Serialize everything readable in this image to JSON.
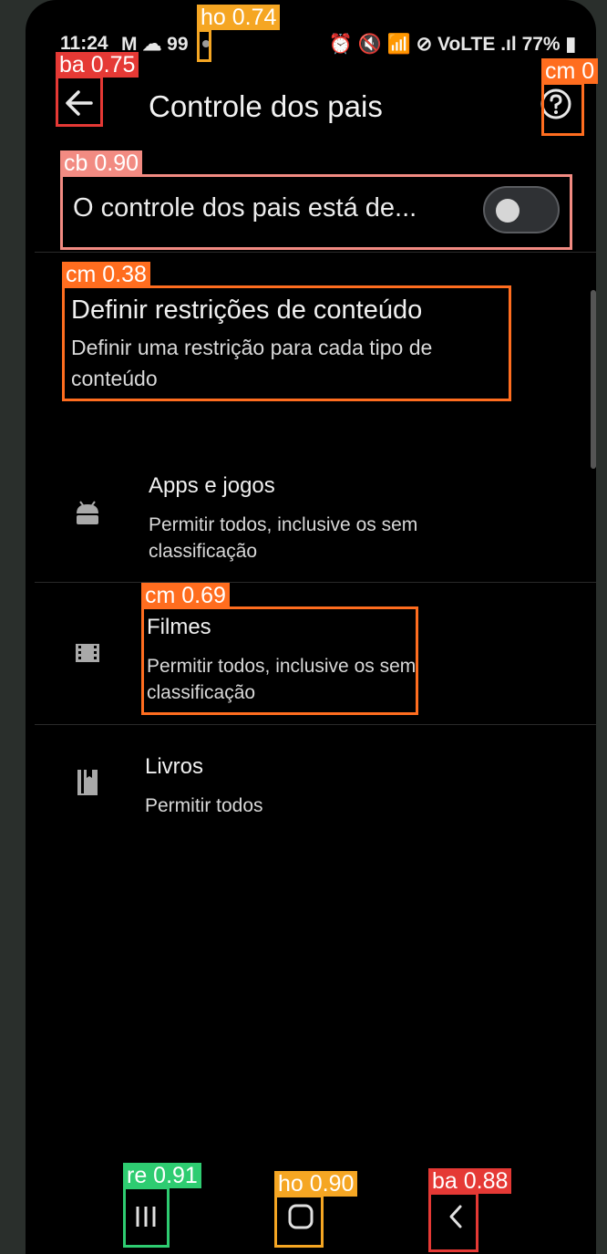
{
  "status_bar": {
    "time": "11:24",
    "left_indicators": "M ☁ 99",
    "right_indicators": "⏰ 🔇 📶 ⊘ VoLTE .ıl",
    "battery": "77%"
  },
  "app_bar": {
    "title": "Controle dos pais",
    "back_icon": "arrow-left-icon",
    "help_icon": "help-circle-icon"
  },
  "master_toggle": {
    "label": "O controle dos pais está de...",
    "state": "off"
  },
  "restrictions_section": {
    "title": "Definir restrições de conteúdo",
    "subtitle_line1": "Definir uma restrição para cada tipo de",
    "subtitle_line2": "conteúdo"
  },
  "content_items": [
    {
      "icon": "android-icon",
      "title": "Apps e jogos",
      "subtitle_line1": "Permitir todos, inclusive os sem",
      "subtitle_line2": "classificação"
    },
    {
      "icon": "film-icon",
      "title": "Filmes",
      "subtitle_line1": "Permitir todos, inclusive os sem",
      "subtitle_line2": "classificação"
    },
    {
      "icon": "book-icon",
      "title": "Livros",
      "subtitle_line1": "Permitir todos",
      "subtitle_line2": ""
    }
  ],
  "nav_bar": {
    "recents_icon": "recents-icon",
    "home_icon": "home-icon",
    "back_icon": "chevron-left-icon"
  },
  "detections": [
    {
      "label": "ho 0.74",
      "color": "#f5a623"
    },
    {
      "label": "ba 0.75",
      "color": "#e53935"
    },
    {
      "label": "cm 0",
      "color": "#ff6d1f"
    },
    {
      "label": "cb 0.90",
      "color": "#f28b82"
    },
    {
      "label": "cm 0.38",
      "color": "#ff6d1f"
    },
    {
      "label": "cm 0.69",
      "color": "#ff6d1f"
    },
    {
      "label": "re 0.91",
      "color": "#2ecc71"
    },
    {
      "label": "ho 0.90",
      "color": "#f5a623"
    },
    {
      "label": "ba 0.88",
      "color": "#e53935"
    }
  ]
}
